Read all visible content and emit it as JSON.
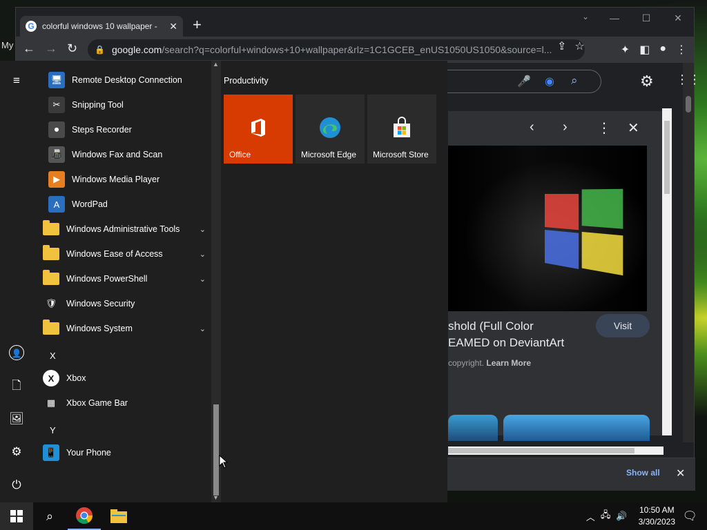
{
  "desktop": {
    "text": "My"
  },
  "browser": {
    "tab_title": "colorful windows 10 wallpaper - ",
    "url_host": "google.com",
    "url_rest": "/search?q=colorful+windows+10+wallpaper&rlz=1C1GCEB_enUS1050US1050&source=l...",
    "preview": {
      "title_line1": "shold (Full Color",
      "title_line2": "EAMED on DeviantArt",
      "subtitle": "copyright.",
      "learn_more": "Learn More",
      "visit_label": "Visit"
    },
    "download_bar": {
      "show_all": "Show all"
    }
  },
  "start_menu": {
    "apps": [
      {
        "label": "Remote Desktop Connection",
        "icon": "remote-desktop-icon",
        "has_chevron": false
      },
      {
        "label": "Snipping Tool",
        "icon": "snipping-tool-icon",
        "has_chevron": false
      },
      {
        "label": "Steps Recorder",
        "icon": "steps-recorder-icon",
        "has_chevron": false
      },
      {
        "label": "Windows Fax and Scan",
        "icon": "fax-scan-icon",
        "has_chevron": false
      },
      {
        "label": "Windows Media Player",
        "icon": "media-player-icon",
        "has_chevron": false
      },
      {
        "label": "WordPad",
        "icon": "wordpad-icon",
        "has_chevron": false
      },
      {
        "label": "Windows Administrative Tools",
        "icon": "folder-icon",
        "has_chevron": true
      },
      {
        "label": "Windows Ease of Access",
        "icon": "folder-icon",
        "has_chevron": true
      },
      {
        "label": "Windows PowerShell",
        "icon": "folder-icon",
        "has_chevron": true
      },
      {
        "label": "Windows Security",
        "icon": "shield-icon",
        "has_chevron": false
      },
      {
        "label": "Windows System",
        "icon": "folder-icon",
        "has_chevron": true
      }
    ],
    "letter_x": "X",
    "apps_x": [
      {
        "label": "Xbox",
        "icon": "xbox-icon"
      },
      {
        "label": "Xbox Game Bar",
        "icon": "xbox-game-bar-icon"
      }
    ],
    "letter_y": "Y",
    "apps_y": [
      {
        "label": "Your Phone",
        "icon": "phone-icon"
      }
    ],
    "tiles_group": "Productivity",
    "tiles": [
      {
        "label": "Office",
        "color": "#d83b01"
      },
      {
        "label": "Microsoft Edge",
        "color": "#2b2b2b"
      },
      {
        "label": "Microsoft Store",
        "color": "#2b2b2b"
      }
    ]
  },
  "taskbar": {
    "time": "10:50 AM",
    "date": "3/30/2023"
  }
}
